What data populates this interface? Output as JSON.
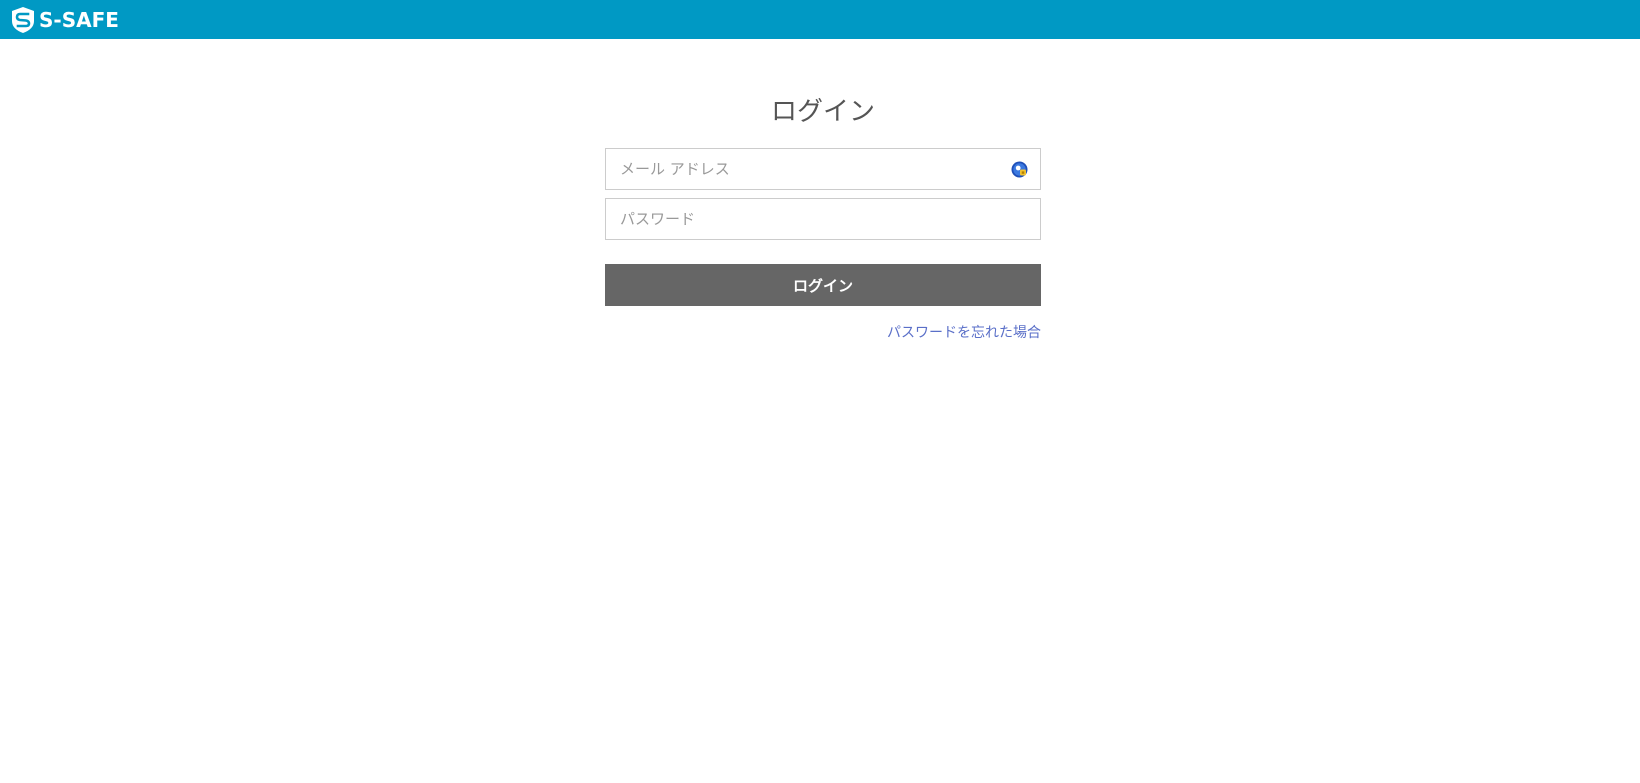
{
  "header": {
    "brand": "S-SAFE",
    "background_color": "#0099c4",
    "logo_icon": "s-shield-icon"
  },
  "login": {
    "title": "ログイン",
    "email": {
      "placeholder": "メール アドレス",
      "value": ""
    },
    "password": {
      "placeholder": "パスワード",
      "value": ""
    },
    "submit_label": "ログイン",
    "submit_color": "#666666",
    "forgot_label": "パスワードを忘れた場合",
    "link_color": "#5a6fc8",
    "autofill_icon": "password-manager-icon"
  }
}
